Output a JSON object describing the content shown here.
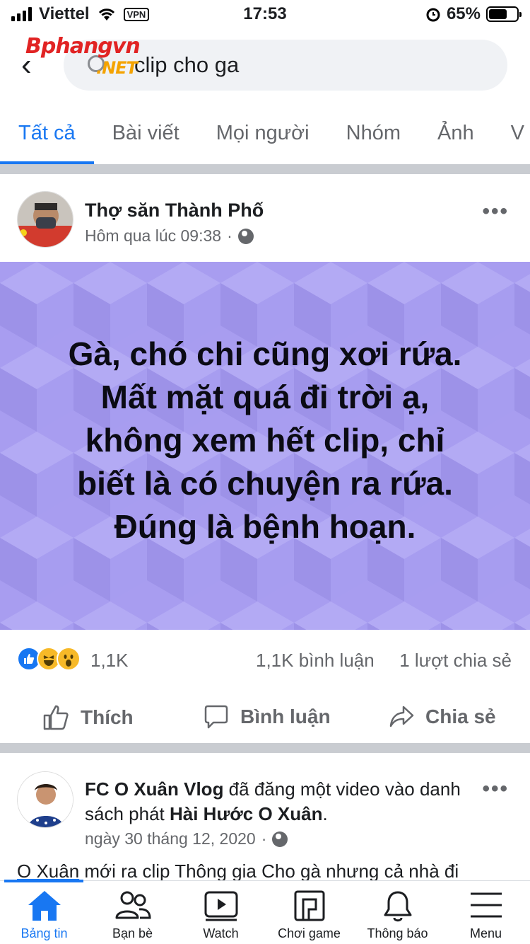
{
  "status_bar": {
    "carrier": "Viettel",
    "vpn": "VPN",
    "time": "17:53",
    "battery": "65%",
    "battery_level": 0.65
  },
  "watermark": {
    "brand": "Bphangvn",
    "suffix": ".NET"
  },
  "search": {
    "query": "clip cho ga"
  },
  "tabs": [
    {
      "label": "Tất cả",
      "active": true
    },
    {
      "label": "Bài viết"
    },
    {
      "label": "Mọi người"
    },
    {
      "label": "Nhóm"
    },
    {
      "label": "Ảnh"
    },
    {
      "label": "V"
    }
  ],
  "post1": {
    "author": "Thợ săn Thành Phố",
    "time": "Hôm qua lúc 09:38",
    "separator": "·",
    "more": "•••",
    "card_lines": [
      "Gà, chó chi cũng xơi rứa.",
      "Mất mặt quá đi trời ạ,",
      "không xem hết clip, chỉ",
      "biết là có chuyện ra rứa.",
      "Đúng là bệnh hoạn."
    ],
    "card_color": "#a89df0",
    "reaction_count": "1,1K",
    "comments": "1,1K bình luận",
    "shares": "1 lượt chia sẻ",
    "actions": {
      "like": "Thích",
      "comment": "Bình luận",
      "share": "Chia sẻ"
    }
  },
  "post2": {
    "author": "FC O Xuân Vlog",
    "action": " đã đăng một video vào danh sách phát ",
    "playlist": "Hài Hước O Xuân",
    "period": ".",
    "time": "ngày 30 tháng 12, 2020",
    "separator": "·",
    "more": "•••",
    "body_link": "O Xuân",
    "body_rest": " mới ra clip Thông gia Cho gà nhưng cả nhà đi"
  },
  "bottom_nav": [
    {
      "label": "Bảng tin",
      "icon": "home-icon",
      "active": true
    },
    {
      "label": "Bạn bè",
      "icon": "friends-icon"
    },
    {
      "label": "Watch",
      "icon": "watch-icon"
    },
    {
      "label": "Chơi game",
      "icon": "gaming-icon"
    },
    {
      "label": "Thông báo",
      "icon": "bell-icon"
    },
    {
      "label": "Menu",
      "icon": "menu-icon"
    }
  ],
  "colors": {
    "accent": "#1877f2",
    "secondary_text": "#65676b"
  }
}
